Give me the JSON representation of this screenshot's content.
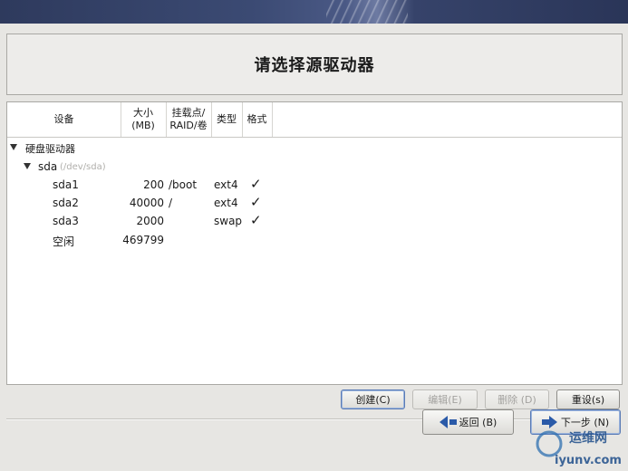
{
  "window": {
    "title": "请选择源驱动器"
  },
  "table": {
    "headers": {
      "device": "设备",
      "size_line1": "大小",
      "size_line2": "(MB)",
      "mount_line1": "挂载点/",
      "mount_line2": "RAID/卷",
      "type": "类型",
      "format": "格式"
    },
    "group_label": "硬盘驱动器",
    "disk": {
      "name": "sda",
      "path": "(/dev/sda)"
    },
    "rows": [
      {
        "device": "sda1",
        "size": "200",
        "mount": "/boot",
        "type": "ext4",
        "format": "✓"
      },
      {
        "device": "sda2",
        "size": "40000",
        "mount": "/",
        "type": "ext4",
        "format": "✓"
      },
      {
        "device": "sda3",
        "size": "2000",
        "mount": "",
        "type": "swap",
        "format": "✓"
      },
      {
        "device": "空闲",
        "size": "469799",
        "mount": "",
        "type": "",
        "format": ""
      }
    ]
  },
  "actions": {
    "create": "创建(C)",
    "edit": "编辑(E)",
    "delete": "删除 (D)",
    "reset": "重设(s)"
  },
  "nav": {
    "back": "返回 (B)",
    "next": "下一步 (N)"
  },
  "watermark": {
    "line1": "运维网",
    "line2": "iyunv.com"
  },
  "colors": {
    "banner": "#2e3a5d",
    "accent": "#2a5aa8",
    "background": "#e7e6e3"
  }
}
